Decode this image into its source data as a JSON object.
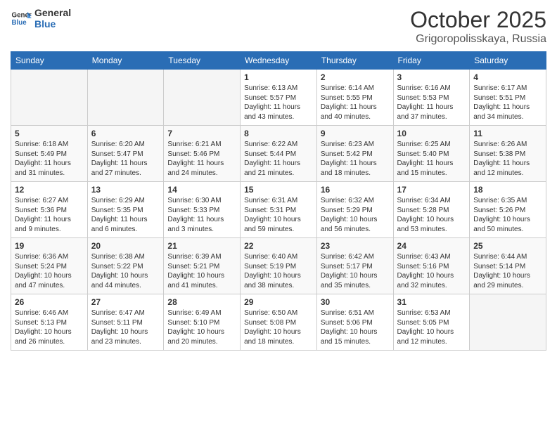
{
  "header": {
    "logo_general": "General",
    "logo_blue": "Blue",
    "month_title": "October 2025",
    "location": "Grigoropolisskaya, Russia"
  },
  "weekdays": [
    "Sunday",
    "Monday",
    "Tuesday",
    "Wednesday",
    "Thursday",
    "Friday",
    "Saturday"
  ],
  "weeks": [
    [
      {
        "day": "",
        "info": ""
      },
      {
        "day": "",
        "info": ""
      },
      {
        "day": "",
        "info": ""
      },
      {
        "day": "1",
        "info": "Sunrise: 6:13 AM\nSunset: 5:57 PM\nDaylight: 11 hours and 43 minutes."
      },
      {
        "day": "2",
        "info": "Sunrise: 6:14 AM\nSunset: 5:55 PM\nDaylight: 11 hours and 40 minutes."
      },
      {
        "day": "3",
        "info": "Sunrise: 6:16 AM\nSunset: 5:53 PM\nDaylight: 11 hours and 37 minutes."
      },
      {
        "day": "4",
        "info": "Sunrise: 6:17 AM\nSunset: 5:51 PM\nDaylight: 11 hours and 34 minutes."
      }
    ],
    [
      {
        "day": "5",
        "info": "Sunrise: 6:18 AM\nSunset: 5:49 PM\nDaylight: 11 hours and 31 minutes."
      },
      {
        "day": "6",
        "info": "Sunrise: 6:20 AM\nSunset: 5:47 PM\nDaylight: 11 hours and 27 minutes."
      },
      {
        "day": "7",
        "info": "Sunrise: 6:21 AM\nSunset: 5:46 PM\nDaylight: 11 hours and 24 minutes."
      },
      {
        "day": "8",
        "info": "Sunrise: 6:22 AM\nSunset: 5:44 PM\nDaylight: 11 hours and 21 minutes."
      },
      {
        "day": "9",
        "info": "Sunrise: 6:23 AM\nSunset: 5:42 PM\nDaylight: 11 hours and 18 minutes."
      },
      {
        "day": "10",
        "info": "Sunrise: 6:25 AM\nSunset: 5:40 PM\nDaylight: 11 hours and 15 minutes."
      },
      {
        "day": "11",
        "info": "Sunrise: 6:26 AM\nSunset: 5:38 PM\nDaylight: 11 hours and 12 minutes."
      }
    ],
    [
      {
        "day": "12",
        "info": "Sunrise: 6:27 AM\nSunset: 5:36 PM\nDaylight: 11 hours and 9 minutes."
      },
      {
        "day": "13",
        "info": "Sunrise: 6:29 AM\nSunset: 5:35 PM\nDaylight: 11 hours and 6 minutes."
      },
      {
        "day": "14",
        "info": "Sunrise: 6:30 AM\nSunset: 5:33 PM\nDaylight: 11 hours and 3 minutes."
      },
      {
        "day": "15",
        "info": "Sunrise: 6:31 AM\nSunset: 5:31 PM\nDaylight: 10 hours and 59 minutes."
      },
      {
        "day": "16",
        "info": "Sunrise: 6:32 AM\nSunset: 5:29 PM\nDaylight: 10 hours and 56 minutes."
      },
      {
        "day": "17",
        "info": "Sunrise: 6:34 AM\nSunset: 5:28 PM\nDaylight: 10 hours and 53 minutes."
      },
      {
        "day": "18",
        "info": "Sunrise: 6:35 AM\nSunset: 5:26 PM\nDaylight: 10 hours and 50 minutes."
      }
    ],
    [
      {
        "day": "19",
        "info": "Sunrise: 6:36 AM\nSunset: 5:24 PM\nDaylight: 10 hours and 47 minutes."
      },
      {
        "day": "20",
        "info": "Sunrise: 6:38 AM\nSunset: 5:22 PM\nDaylight: 10 hours and 44 minutes."
      },
      {
        "day": "21",
        "info": "Sunrise: 6:39 AM\nSunset: 5:21 PM\nDaylight: 10 hours and 41 minutes."
      },
      {
        "day": "22",
        "info": "Sunrise: 6:40 AM\nSunset: 5:19 PM\nDaylight: 10 hours and 38 minutes."
      },
      {
        "day": "23",
        "info": "Sunrise: 6:42 AM\nSunset: 5:17 PM\nDaylight: 10 hours and 35 minutes."
      },
      {
        "day": "24",
        "info": "Sunrise: 6:43 AM\nSunset: 5:16 PM\nDaylight: 10 hours and 32 minutes."
      },
      {
        "day": "25",
        "info": "Sunrise: 6:44 AM\nSunset: 5:14 PM\nDaylight: 10 hours and 29 minutes."
      }
    ],
    [
      {
        "day": "26",
        "info": "Sunrise: 6:46 AM\nSunset: 5:13 PM\nDaylight: 10 hours and 26 minutes."
      },
      {
        "day": "27",
        "info": "Sunrise: 6:47 AM\nSunset: 5:11 PM\nDaylight: 10 hours and 23 minutes."
      },
      {
        "day": "28",
        "info": "Sunrise: 6:49 AM\nSunset: 5:10 PM\nDaylight: 10 hours and 20 minutes."
      },
      {
        "day": "29",
        "info": "Sunrise: 6:50 AM\nSunset: 5:08 PM\nDaylight: 10 hours and 18 minutes."
      },
      {
        "day": "30",
        "info": "Sunrise: 6:51 AM\nSunset: 5:06 PM\nDaylight: 10 hours and 15 minutes."
      },
      {
        "day": "31",
        "info": "Sunrise: 6:53 AM\nSunset: 5:05 PM\nDaylight: 10 hours and 12 minutes."
      },
      {
        "day": "",
        "info": ""
      }
    ]
  ]
}
